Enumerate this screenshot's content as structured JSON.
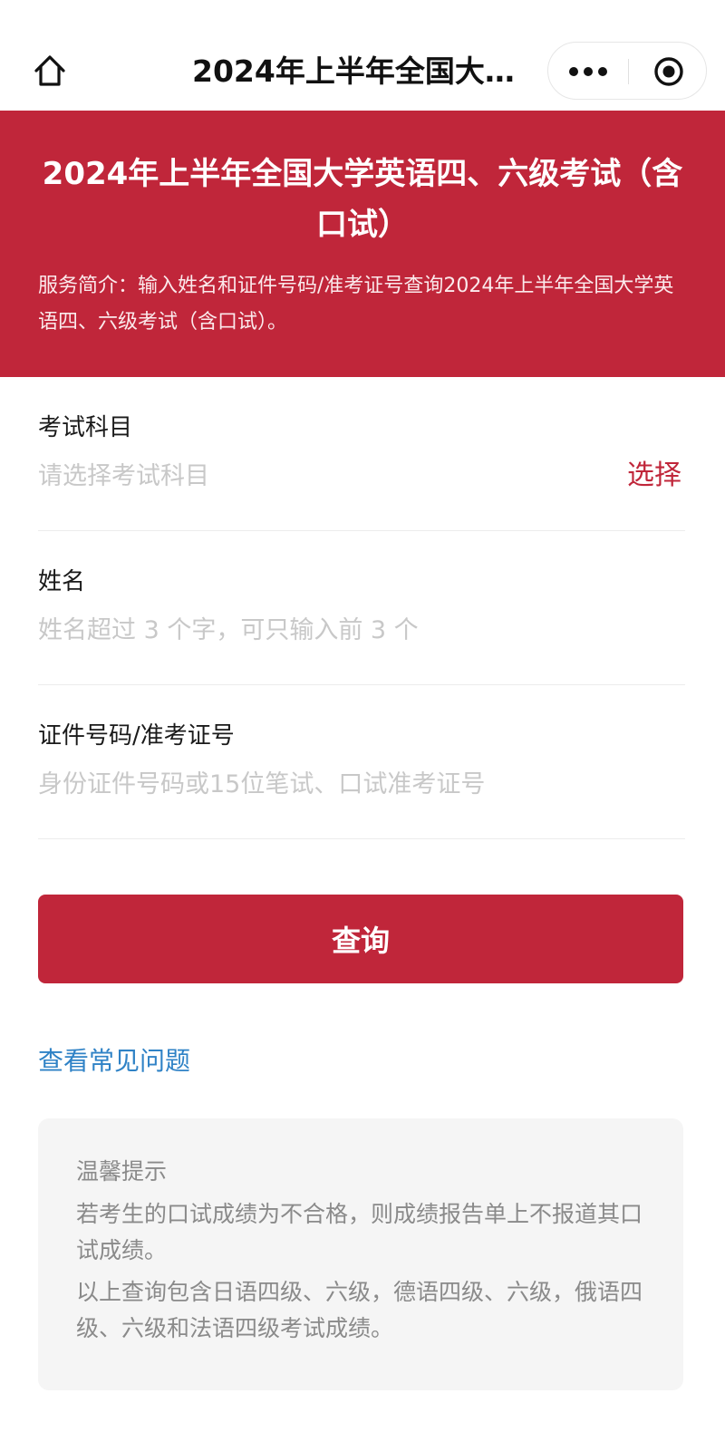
{
  "navbar": {
    "title": "2024年上半年全国大学英语四、六级考试（含口试）",
    "home_icon": "home-icon",
    "more_icon": "more-dots-icon",
    "close_icon": "target-circle-icon"
  },
  "banner": {
    "title": "2024年上半年全国大学英语四、六级考试（含口试）",
    "description": "服务简介：输入姓名和证件号码/准考证号查询2024年上半年全国大学英语四、六级考试（含口试）。",
    "background_color": "#c0263a"
  },
  "form": {
    "subject": {
      "label": "考试科目",
      "placeholder": "请选择考试科目",
      "value": "",
      "select_label": "选择"
    },
    "name": {
      "label": "姓名",
      "placeholder": "姓名超过 3 个字，可只输入前 3 个",
      "value": ""
    },
    "id": {
      "label": "证件号码/准考证号",
      "placeholder": "身份证件号码或15位笔试、口试准考证号",
      "value": ""
    },
    "submit_label": "查询"
  },
  "faq_link": "查看常见问题",
  "tips": {
    "title": "温馨提示",
    "items": [
      "若考生的口试成绩为不合格，则成绩报告单上不报道其口试成绩。",
      "以上查询包含日语四级、六级，德语四级、六级，俄语四级、六级和法语四级考试成绩。"
    ]
  },
  "colors": {
    "accent": "#c0263a",
    "link": "#2f82c6",
    "tips_bg": "#f5f5f5"
  }
}
